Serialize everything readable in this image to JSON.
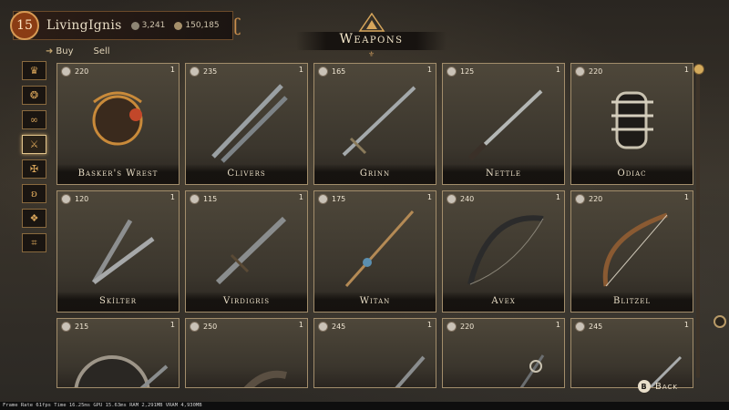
{
  "player": {
    "level": "15",
    "name": "LivingIgnis",
    "currency_a": "3,241",
    "currency_b": "150,185"
  },
  "title": "Weapons",
  "tabs": {
    "buy": "Buy",
    "sell": "Sell"
  },
  "categories": [
    {
      "icon": "crown-icon"
    },
    {
      "icon": "helmet-icon"
    },
    {
      "icon": "rings-icon"
    },
    {
      "icon": "weapon-icon",
      "active": true
    },
    {
      "icon": "armor-icon"
    },
    {
      "icon": "bag-icon"
    },
    {
      "icon": "gems-icon"
    },
    {
      "icon": "misc-icon"
    }
  ],
  "items": [
    {
      "price": "220",
      "qty": "1",
      "name": "Basker's Wrest"
    },
    {
      "price": "235",
      "qty": "1",
      "name": "Clivers"
    },
    {
      "price": "165",
      "qty": "1",
      "name": "Grinn"
    },
    {
      "price": "125",
      "qty": "1",
      "name": "Nettle"
    },
    {
      "price": "220",
      "qty": "1",
      "name": "Odiac"
    },
    {
      "price": "120",
      "qty": "1",
      "name": "Skílter"
    },
    {
      "price": "115",
      "qty": "1",
      "name": "Virdigris"
    },
    {
      "price": "175",
      "qty": "1",
      "name": "Witan"
    },
    {
      "price": "240",
      "qty": "1",
      "name": "Avex"
    },
    {
      "price": "220",
      "qty": "1",
      "name": "Blitzel"
    },
    {
      "price": "215",
      "qty": "1",
      "name": ""
    },
    {
      "price": "250",
      "qty": "1",
      "name": ""
    },
    {
      "price": "245",
      "qty": "1",
      "name": ""
    },
    {
      "price": "220",
      "qty": "1",
      "name": ""
    },
    {
      "price": "245",
      "qty": "1",
      "name": ""
    }
  ],
  "back": {
    "key": "B",
    "label": "Back"
  },
  "debug": "Frame Rate 61fps  Time 16.25ms  GPU 15.63ms  RAM 2,291MB  VRAM 4,930MB",
  "colors": {
    "accent": "#d4aa5c",
    "frame": "#a28d6b",
    "level_badge": "#8a3c14"
  }
}
